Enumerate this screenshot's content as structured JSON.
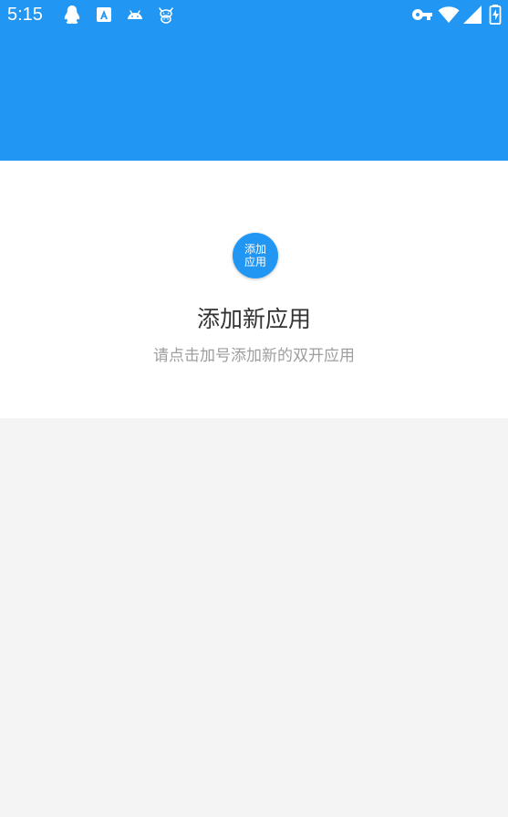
{
  "status_bar": {
    "time": "5:15",
    "notification_icons": [
      "qq-penguin-icon",
      "app-store-a-icon",
      "android-icon",
      "cow-icon"
    ],
    "system_icons": [
      "vpn-key-icon",
      "wifi-icon",
      "cellular-signal-icon",
      "battery-charging-icon"
    ]
  },
  "header": {
    "color": "#2196f3"
  },
  "empty_state": {
    "add_button_label": "添加应用",
    "title": "添加新应用",
    "subtitle": "请点击加号添加新的双开应用"
  }
}
